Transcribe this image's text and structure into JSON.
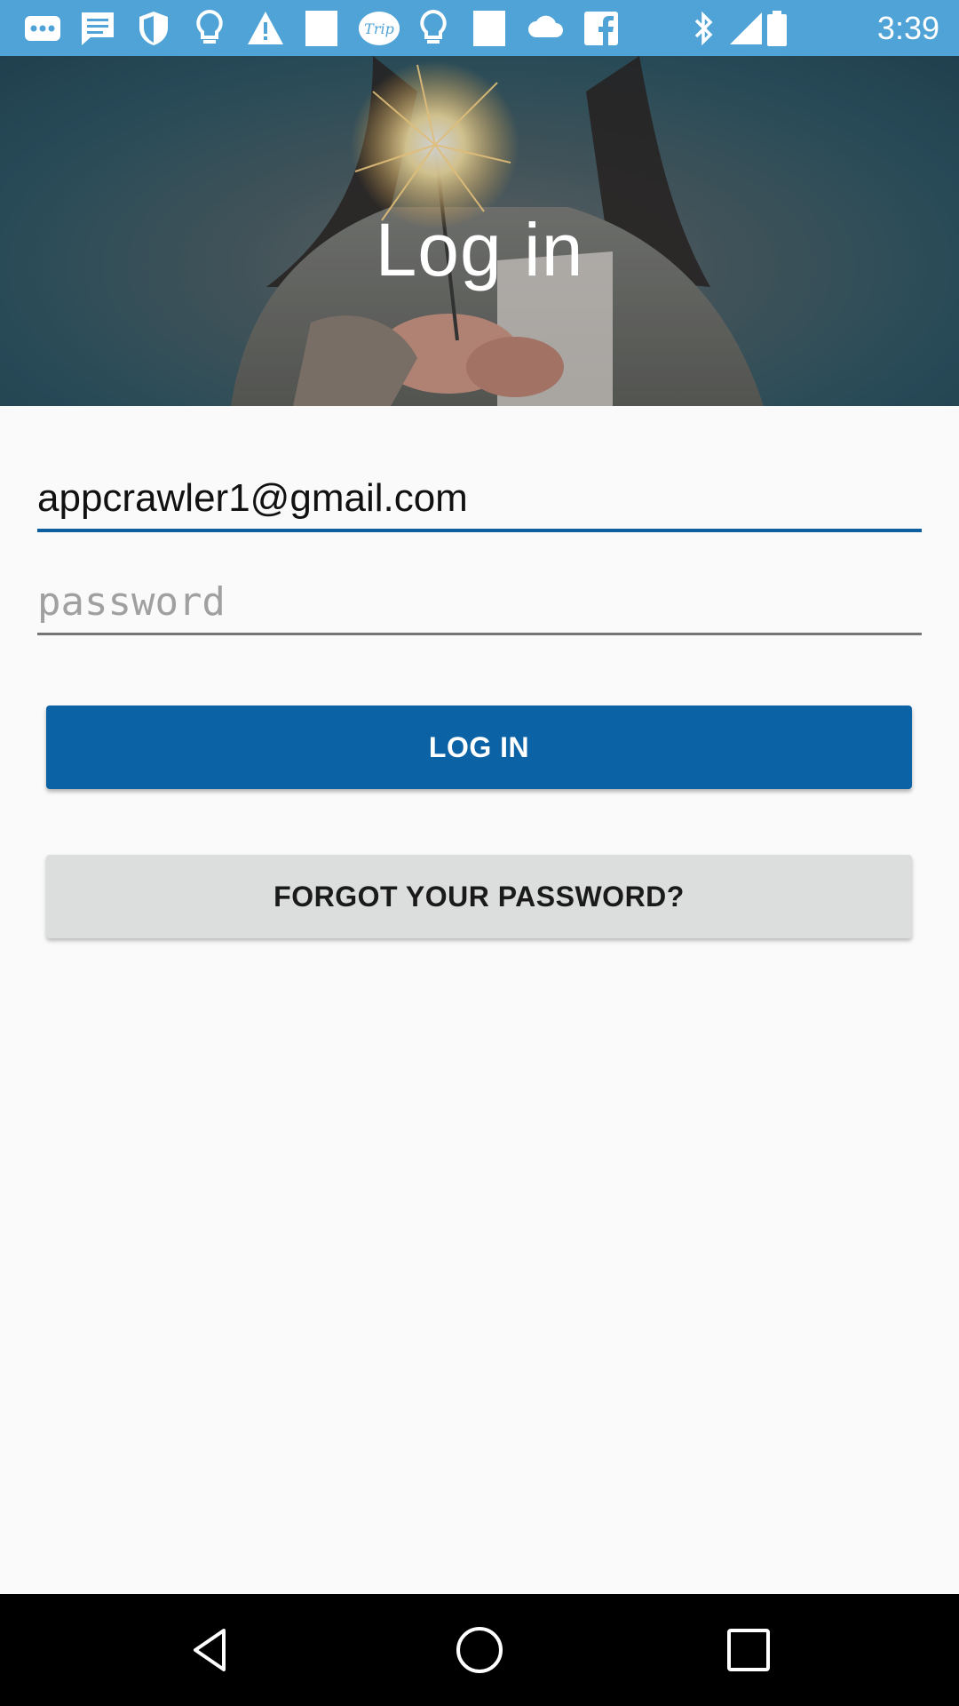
{
  "status_bar": {
    "time": "3:39",
    "icons": [
      "more-icon",
      "message-icon",
      "shield-icon",
      "bulb-icon",
      "alert-icon",
      "square-icon",
      "trip-icon",
      "bulb-icon",
      "square-icon",
      "cloud-icon",
      "facebook-icon",
      "bluetooth-icon",
      "signal-icon",
      "battery-icon"
    ],
    "trip_badge": "Trip"
  },
  "hero": {
    "title": "Log in"
  },
  "form": {
    "email_value": "appcrawler1@gmail.com",
    "password_placeholder": "password",
    "login_label": "LOG IN",
    "forgot_label": "FORGOT YOUR PASSWORD?"
  },
  "colors": {
    "status_bar": "#4fa3d6",
    "primary": "#0b62a4",
    "secondary_button": "#dcdddd",
    "background": "#fafafa"
  },
  "nav_bar": {
    "icons": [
      "back-icon",
      "home-icon",
      "recents-icon"
    ]
  }
}
